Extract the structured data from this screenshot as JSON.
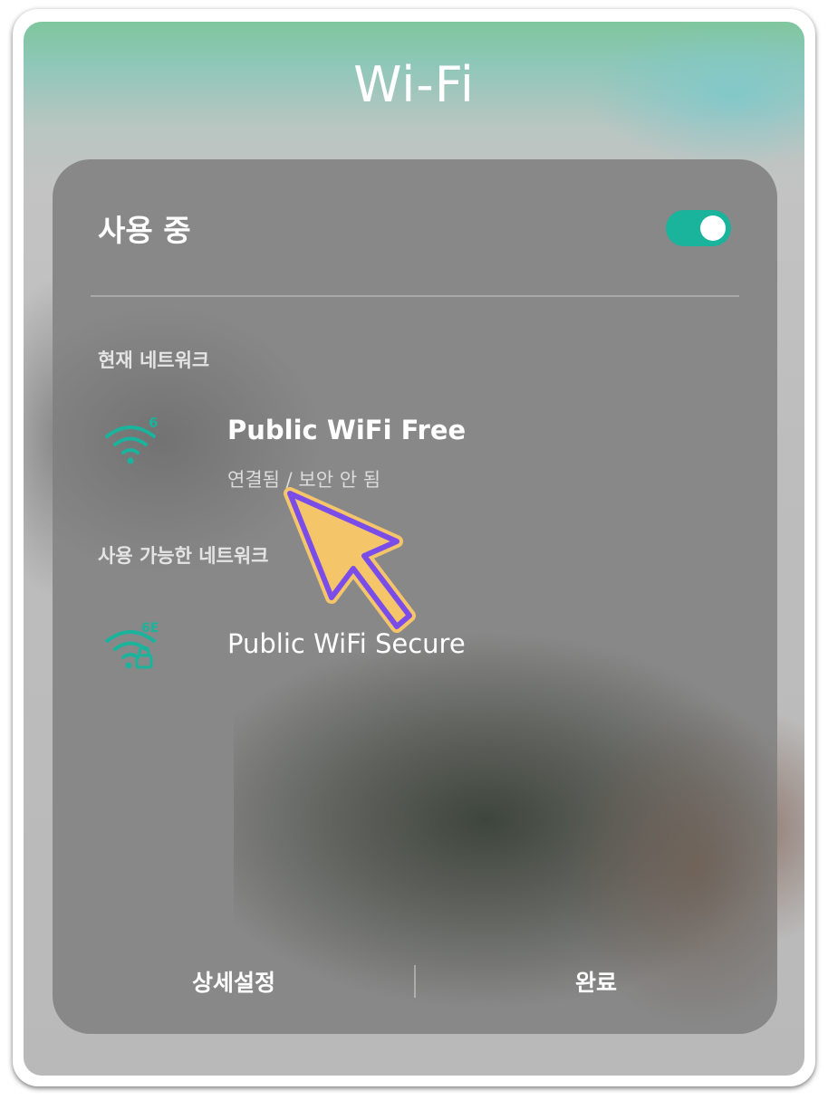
{
  "title": "Wi-Fi",
  "wifi_toggle": {
    "label": "사용 중",
    "on": true
  },
  "current_section": {
    "label": "현재 네트워크"
  },
  "current_network": {
    "name": "Public WiFi Free",
    "status": "연결됨 / 보안 안 됨",
    "badge": "6",
    "icon": "wifi-6-icon"
  },
  "available_section": {
    "label": "사용 가능한 네트워크"
  },
  "available_networks": [
    {
      "name": "Public WiFi Secure",
      "badge": "6E",
      "icon": "wifi-6e-lock-icon"
    }
  ],
  "footer": {
    "settings_label": "상세설정",
    "done_label": "완료"
  },
  "colors": {
    "accent": "#1ab39c",
    "panel": "#888888",
    "cursor_fill": "#7b4de8",
    "cursor_outline": "#f5c56a"
  }
}
